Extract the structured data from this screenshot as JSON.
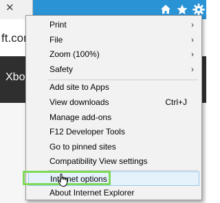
{
  "browser": {
    "url_fragment": "ft.com",
    "page_banner_text": "Xbo",
    "toolbar_icons": [
      "home-icon",
      "star-icon",
      "gear-icon"
    ],
    "colors": {
      "toolbar_bg": "#2a93d5",
      "highlight_outline": "#7ed957",
      "hover_bg": "#e5f1fb",
      "hover_border": "#99c9ef"
    }
  },
  "menu": {
    "group1": [
      {
        "label": "Print",
        "submenu": "›"
      },
      {
        "label": "File",
        "submenu": "›"
      },
      {
        "label": "Zoom (100%)",
        "submenu": "›"
      },
      {
        "label": "Safety",
        "submenu": "›"
      }
    ],
    "group2": [
      {
        "label": "Add site to Apps"
      },
      {
        "label": "View downloads",
        "shortcut": "Ctrl+J"
      },
      {
        "label": "Manage add-ons"
      },
      {
        "label": "F12 Developer Tools"
      },
      {
        "label": "Go to pinned sites"
      },
      {
        "label": "Compatibility View settings"
      }
    ],
    "group3": [
      {
        "label": "Internet options"
      },
      {
        "label": "About Internet Explorer"
      }
    ]
  }
}
